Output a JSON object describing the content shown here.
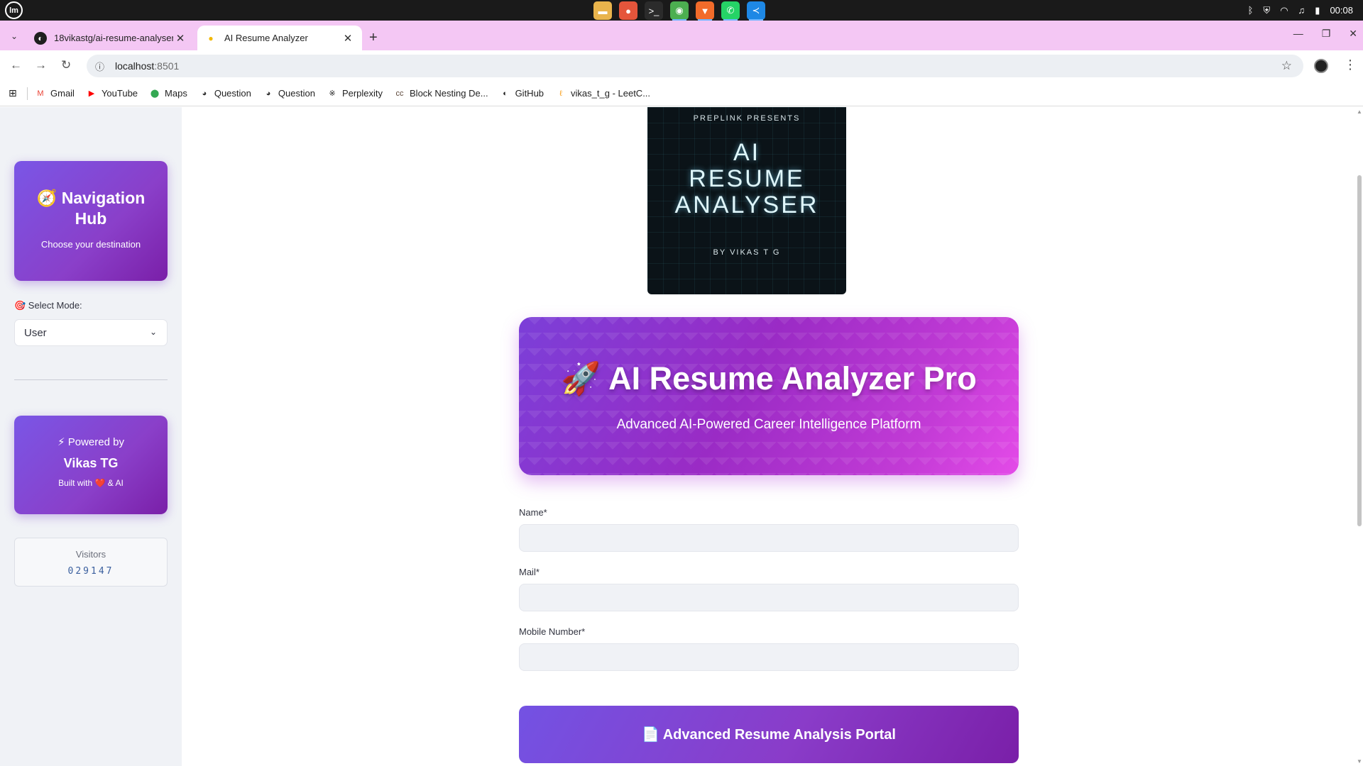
{
  "os": {
    "logo_text": "lm",
    "clock": "00:08",
    "taskbar_apps": [
      {
        "icon": "folder-icon",
        "glyph": "▬",
        "color": "#e9b44c",
        "active": false
      },
      {
        "icon": "app-red-icon",
        "glyph": "●",
        "color": "#e5553b",
        "active": false
      },
      {
        "icon": "terminal-icon",
        "glyph": ">_",
        "color": "#2b2b2b",
        "active": false
      },
      {
        "icon": "chrome-icon",
        "glyph": "◉",
        "color": "#4caf50",
        "active": true
      },
      {
        "icon": "brave-icon",
        "glyph": "▼",
        "color": "#f26b2a",
        "active": true
      },
      {
        "icon": "whatsapp-icon",
        "glyph": "✆",
        "color": "#25d366",
        "active": true
      },
      {
        "icon": "vscode-icon",
        "glyph": "≺",
        "color": "#1e88e5",
        "active": true
      }
    ]
  },
  "browser": {
    "tabs": [
      {
        "title": "18vikastg/ai-resume-analyser",
        "favicon": "github-icon",
        "active": false
      },
      {
        "title": "AI Resume Analyzer",
        "favicon": "location-pin-icon",
        "active": true
      }
    ],
    "url_host": "localhost",
    "url_port": ":8501",
    "bookmarks": [
      {
        "label": "Gmail",
        "icon": "gmail-icon",
        "glyph": "M",
        "color": "#ea4335"
      },
      {
        "label": "YouTube",
        "icon": "youtube-icon",
        "glyph": "▶",
        "color": "#ff0000"
      },
      {
        "label": "Maps",
        "icon": "maps-icon",
        "glyph": "⬤",
        "color": "#34a853"
      },
      {
        "label": "Question",
        "icon": "globe-icon",
        "glyph": "◕",
        "color": "#333333"
      },
      {
        "label": "Question",
        "icon": "globe-icon",
        "glyph": "◕",
        "color": "#333333"
      },
      {
        "label": "Perplexity",
        "icon": "perplexity-icon",
        "glyph": "※",
        "color": "#1f1f1f"
      },
      {
        "label": "Block Nesting De...",
        "icon": "codechef-icon",
        "glyph": "cc",
        "color": "#5b4638"
      },
      {
        "label": "GitHub",
        "icon": "github-icon",
        "glyph": "◐",
        "color": "#1f1f1f"
      },
      {
        "label": "vikas_t_g - LeetC...",
        "icon": "leetcode-icon",
        "glyph": "ℓ",
        "color": "#f89f1b"
      }
    ]
  },
  "sidebar": {
    "nav_title_line1": "🧭 Navigation",
    "nav_title_line2": "Hub",
    "nav_subtitle": "Choose your destination",
    "mode_label": "🎯 Select Mode:",
    "mode_value": "User",
    "powered_by": "⚡ Powered by",
    "author": "Vikas TG",
    "built_with": "Built with ❤️ & AI",
    "visitors_label": "Visitors",
    "visitors_count": "029147"
  },
  "main": {
    "cover": {
      "presents": "PREPLINK PRESENTS",
      "title_line1": "AI",
      "title_line2": "RESUME",
      "title_line3": "ANALYSER",
      "byline": "BY VIKAS T G"
    },
    "hero_title": "🚀 AI Resume Analyzer Pro",
    "hero_subtitle": "Advanced AI-Powered Career Intelligence Platform",
    "fields": [
      {
        "label": "Name*",
        "value": ""
      },
      {
        "label": "Mail*",
        "value": ""
      },
      {
        "label": "Mobile Number*",
        "value": ""
      }
    ],
    "portal_button": "📄 Advanced Resume Analysis Portal"
  }
}
